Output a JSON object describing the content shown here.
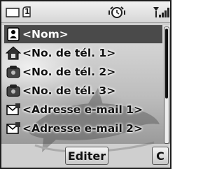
{
  "status_bar": {
    "icons": [
      "envelope-icon",
      "line-1-icon",
      "alarm-clock-icon",
      "signal-strength-icon"
    ],
    "line_number": "1"
  },
  "contact_fields": [
    {
      "icon": "name-card-icon",
      "label": "<Nom>",
      "selected": true
    },
    {
      "icon": "home-phone-icon",
      "label": "<No. de tél. 1>",
      "selected": false
    },
    {
      "icon": "phone-icon",
      "label": "<No. de tél. 2>",
      "selected": false
    },
    {
      "icon": "phone-icon",
      "label": "<No. de tél. 3>",
      "selected": false
    },
    {
      "icon": "email-icon",
      "label": "<Adresse e-mail 1>",
      "selected": false
    },
    {
      "icon": "email-icon",
      "label": "<Adresse e-mail 2>",
      "selected": false
    }
  ],
  "softkeys": {
    "center": "Editer",
    "right": "C"
  },
  "colors": {
    "selection": "#4a4a4a",
    "text": "#111111",
    "screen_bg": "#cfcfcf"
  }
}
